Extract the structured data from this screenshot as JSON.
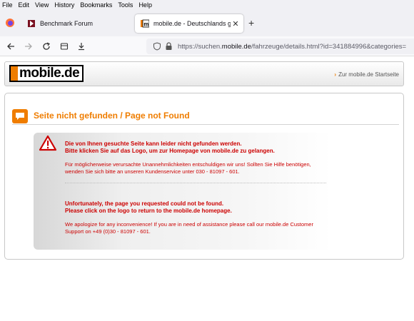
{
  "menubar": {
    "items": [
      "File",
      "Edit",
      "View",
      "History",
      "Bookmarks",
      "Tools",
      "Help"
    ]
  },
  "tabs": [
    {
      "title": "Benchmark Forum",
      "close": "✕"
    },
    {
      "title": "mobile.de - Deutschlands größter Fahrzeugmarkt",
      "close": "✕"
    }
  ],
  "new_tab_label": "+",
  "address_bar": {
    "url_prefix": "https://suchen.",
    "url_domain": "mobile.de",
    "url_suffix": "/fahrzeuge/details.html?id=341884996&categories="
  },
  "header": {
    "logo_text": "mobile.de",
    "start_link": "Zur mobile.de Startseite"
  },
  "error": {
    "title": "Seite nicht gefunden / Page not Found",
    "de_main": "Die von Ihnen gesuchte Seite kann leider nicht gefunden werden.\nBitte klicken Sie auf das Logo, um zur Homepage von mobile.de zu gelangen.",
    "de_sub": "Für möglicherweise verursachte Unannehmlichkeiten entschuldigen wir uns! Sollten Sie Hilfe benötigen, wenden Sie sich bitte an unseren Kundenservice unter 030 - 81097 - 601.",
    "en_main": "Unfortunately, the page you requested could not be found.\nPlease click on the logo to return to the mobile.de homepage.",
    "en_sub": "We apologize for any inconvenience! If you are in need of assistance please call our mobile.de Customer Support on +49 (0)30 - 81097 - 601."
  },
  "colors": {
    "brand_orange": "#ef7d00",
    "error_red": "#cc0000"
  }
}
